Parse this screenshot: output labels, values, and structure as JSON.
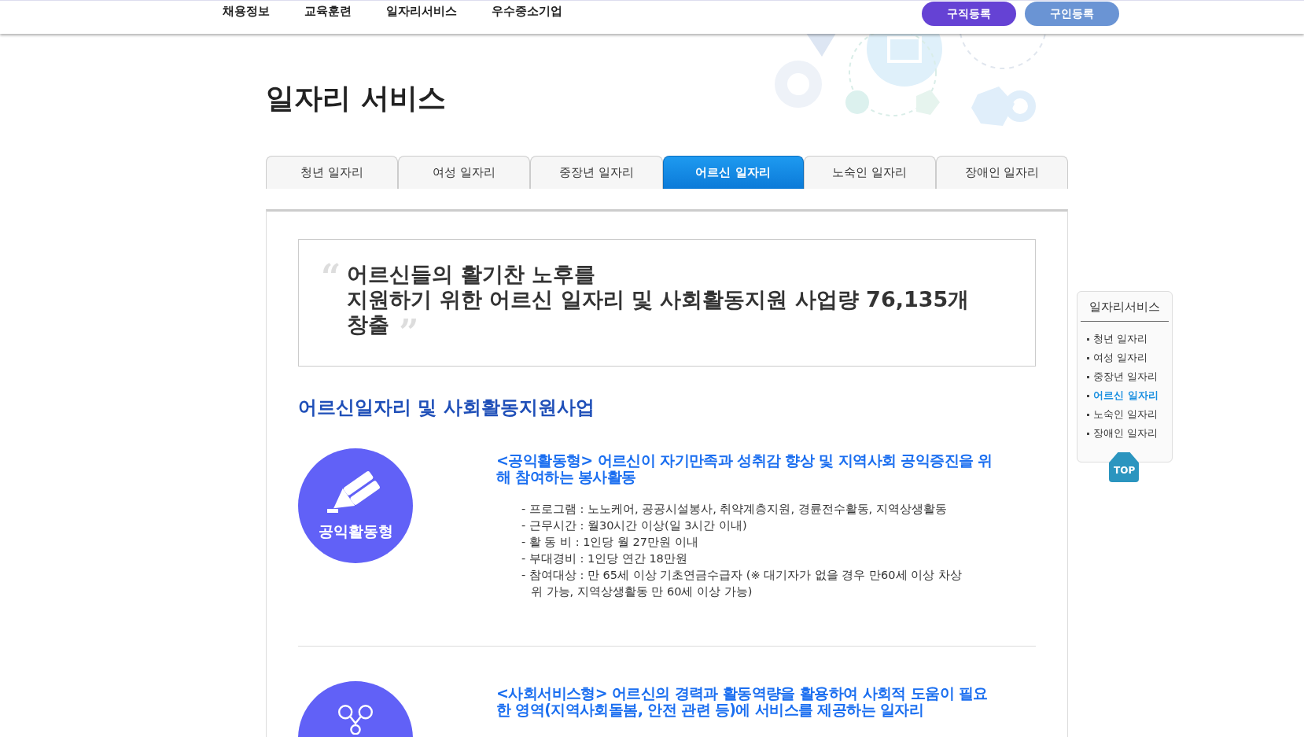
{
  "nav": {
    "items": [
      "채용정보",
      "교육훈련",
      "일자리서비스",
      "우수중소기업"
    ],
    "buttons": [
      {
        "label": "구직등록",
        "kind": "primary"
      },
      {
        "label": "구인등록",
        "kind": "secondary"
      }
    ]
  },
  "page_title": "일자리 서비스",
  "tabs": [
    {
      "label": "청년 일자리",
      "selected": false
    },
    {
      "label": "여성 일자리",
      "selected": false
    },
    {
      "label": "중장년 일자리",
      "selected": false
    },
    {
      "label": "어르신 일자리",
      "selected": true
    },
    {
      "label": "노숙인 일자리",
      "selected": false
    },
    {
      "label": "장애인 일자리",
      "selected": false
    }
  ],
  "quote": {
    "open_mark": "“",
    "close_mark": "”",
    "lines": [
      "어르신들의 활기찬 노후를",
      "지원하기 위한 어르신 일자리 및 사회활동지원 사업량 76,135개",
      "창출"
    ]
  },
  "section_title": "어르신일자리 및 사회활동지원사업",
  "programs": [
    {
      "kind": "pencil",
      "badge": "공익활동형",
      "title": "<공익활동형> 어르신이 자기만족과 성취감 향상 및 지역사회 공익증진을 위해 참여하는 봉사활동",
      "details": [
        "- 프로그램 : 노노케어, 공공시설봉사, 취약계층지원, 경륜전수활동, 지역상생활동",
        "- 근무시간 : 월30시간 이상(일 3시간 이내)",
        "- 활 동 비 : 1인당 월 27만원 이내",
        "- 부대경비 : 1인당 연간 18만원",
        "- 참여대상 : 만 65세 이상 기초연금수급자 (※ 대기자가 없을 경우 만60세 이상 차상위 가능, 지역상생활동 만 60세 이상 가능)"
      ]
    },
    {
      "kind": "people",
      "title": "<사회서비스형> 어르신의 경력과 활동역량을 활용하여 사회적 도움이 필요한 영역(지역사회돌봄, 안전 관련 등)에 서비스를 제공하는 일자리"
    }
  ],
  "sidebar": {
    "title": "일자리서비스",
    "items": [
      {
        "label": "청년 일자리",
        "selected": false
      },
      {
        "label": "여성 일자리",
        "selected": false
      },
      {
        "label": "중장년 일자리",
        "selected": false
      },
      {
        "label": "어르신 일자리",
        "selected": true
      },
      {
        "label": "노숙인 일자리",
        "selected": false
      },
      {
        "label": "장애인 일자리",
        "selected": false
      }
    ]
  },
  "top_button": "TOP"
}
